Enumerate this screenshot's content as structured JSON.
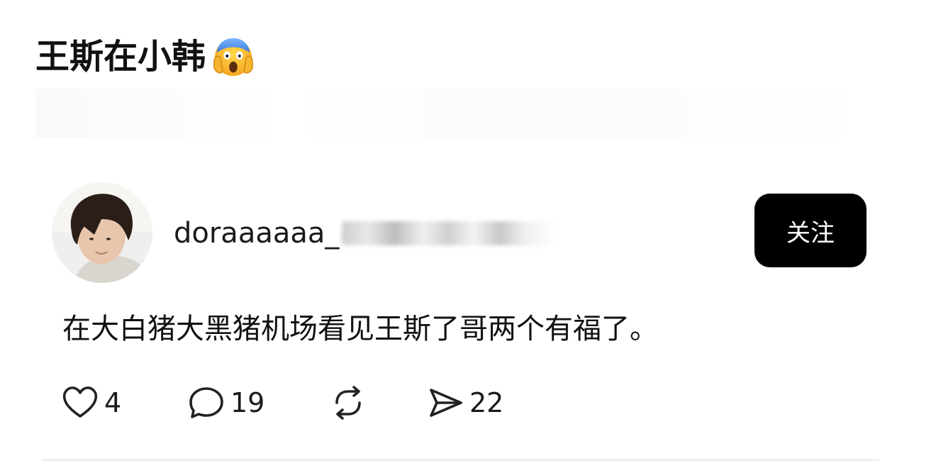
{
  "header": {
    "title": "王斯在小韩",
    "emoji": "face-screaming-in-fear"
  },
  "post": {
    "username": "doraaaaaa_",
    "follow_label": "关注",
    "text": "在大白猪大黑猪机场看见王斯了哥两个有福了。",
    "actions": {
      "like_count": "4",
      "comment_count": "19",
      "share_count": "22"
    }
  },
  "colors": {
    "button_bg": "#000000",
    "button_text": "#ffffff",
    "text": "#111111"
  },
  "icons": [
    "heart-icon",
    "comment-icon",
    "repost-icon",
    "send-icon"
  ]
}
